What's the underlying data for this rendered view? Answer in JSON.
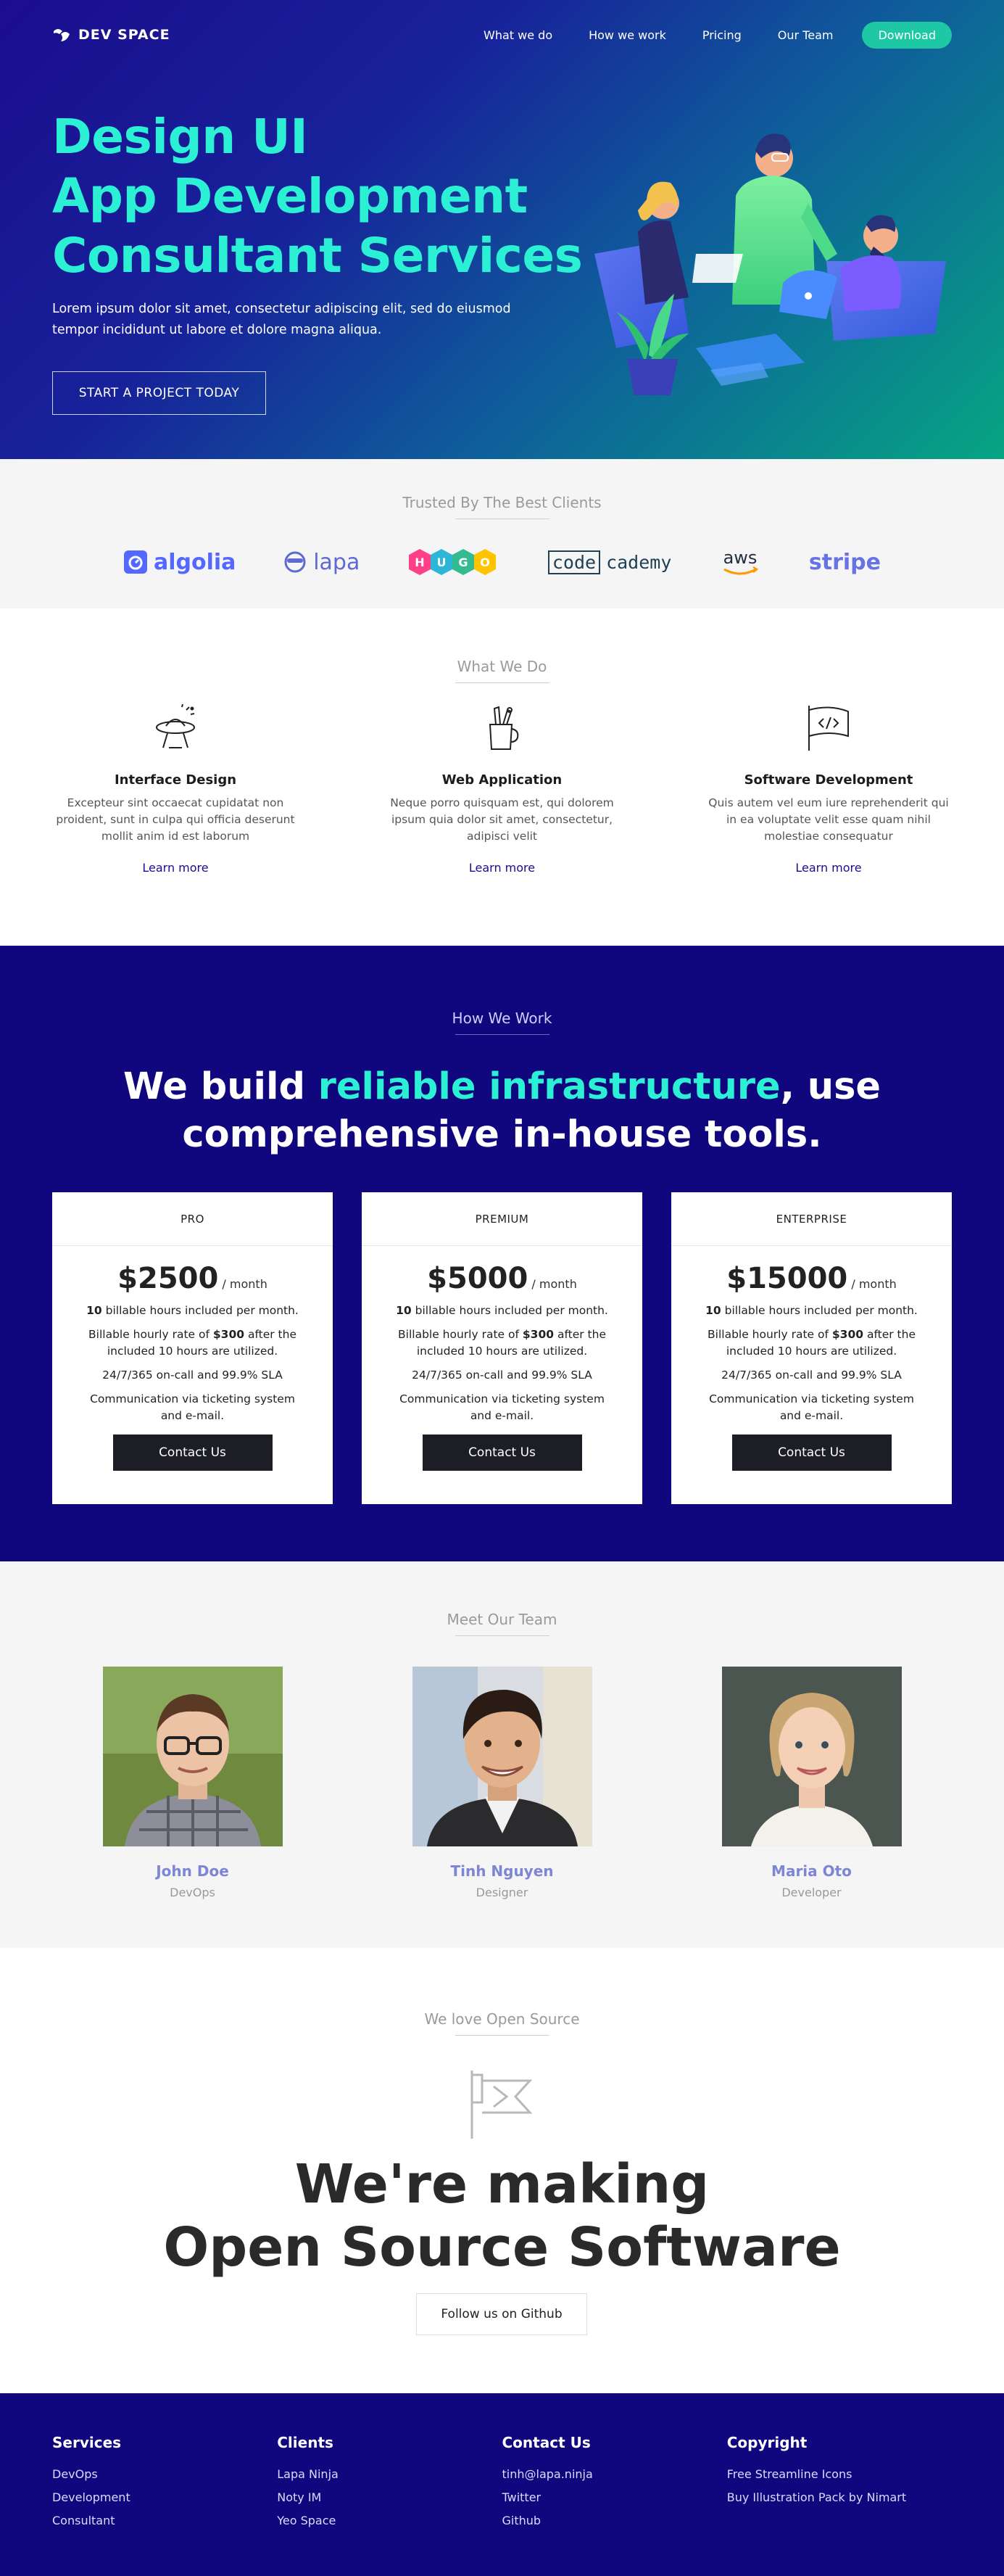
{
  "brand": {
    "name": "DEV SPACE"
  },
  "nav": {
    "links": [
      "What we do",
      "How we work",
      "Pricing",
      "Our Team"
    ],
    "download": "Download"
  },
  "hero": {
    "title_lines": [
      "Design UI",
      "App Development",
      "Consultant Services"
    ],
    "subtitle": "Lorem ipsum dolor sit amet, consectetur adipiscing elit, sed do eiusmod tempor incididunt ut labore et dolore magna aliqua.",
    "cta": "START A PROJECT TODAY"
  },
  "clients": {
    "heading": "Trusted By The Best Clients",
    "logos": [
      "algolia",
      "lapa",
      "HUGO",
      "codecademy",
      "aws",
      "stripe"
    ]
  },
  "whatwedo": {
    "heading": "What We Do",
    "services": [
      {
        "title": "Interface Design",
        "desc": "Excepteur sint occaecat cupidatat non proident, sunt in culpa qui officia deserunt mollit anim id est laborum",
        "link": "Learn more",
        "icon": "ufo-icon"
      },
      {
        "title": "Web Application",
        "desc": "Neque porro quisquam est, qui dolorem ipsum quia dolor sit amet, consectetur, adipisci velit",
        "link": "Learn more",
        "icon": "pencil-cup-icon"
      },
      {
        "title": "Software Development",
        "desc": "Quis autem vel eum iure reprehenderit qui in ea voluptate velit esse quam nihil molestiae consequatur",
        "link": "Learn more",
        "icon": "code-flag-icon"
      }
    ]
  },
  "howwework": {
    "heading": "How We Work",
    "title_part1": "We build ",
    "title_accent": "reliable infrastructure",
    "title_part2": ", use",
    "title_line2": "comprehensive in-house tools.",
    "per_label": "/ month",
    "hours_text": " billable hours included per month.",
    "rate_before": "Billable hourly rate of ",
    "rate_after": " after the included 10 hours are utilized.",
    "sla": "24/7/365 on-call and 99.9% SLA",
    "comm": "Communication via ticketing system and e-mail.",
    "cta": "Contact Us",
    "plans": [
      {
        "name": "PRO",
        "price": "$2500",
        "hours": "10",
        "rate": "$300"
      },
      {
        "name": "PREMIUM",
        "price": "$5000",
        "hours": "10",
        "rate": "$300"
      },
      {
        "name": "ENTERPRISE",
        "price": "$15000",
        "hours": "10",
        "rate": "$300"
      }
    ]
  },
  "team": {
    "heading": "Meet Our Team",
    "members": [
      {
        "name": "John Doe",
        "role": "DevOps"
      },
      {
        "name": "Tinh Nguyen",
        "role": "Designer"
      },
      {
        "name": "Maria Oto",
        "role": "Developer"
      }
    ]
  },
  "opensource": {
    "heading": "We love Open Source",
    "title_line1": "We're making",
    "title_line2": "Open Source Software",
    "cta": "Follow us on Github"
  },
  "footer": {
    "columns": [
      {
        "title": "Services",
        "items": [
          "DevOps",
          "Development",
          "Consultant"
        ]
      },
      {
        "title": "Clients",
        "items": [
          "Lapa Ninja",
          "Noty IM",
          "Yeo Space"
        ]
      },
      {
        "title": "Contact Us",
        "items": [
          "tinh@lapa.ninja",
          "Twitter",
          "Github"
        ]
      },
      {
        "title": "Copyright",
        "items": [
          "Free Streamline Icons",
          "Buy Illustration Pack by Nimart"
        ]
      }
    ]
  },
  "colors": {
    "primary": "#10067e",
    "accent": "#2bf0d4",
    "download": "#1ec8a5",
    "team_name": "#7c86d4"
  }
}
